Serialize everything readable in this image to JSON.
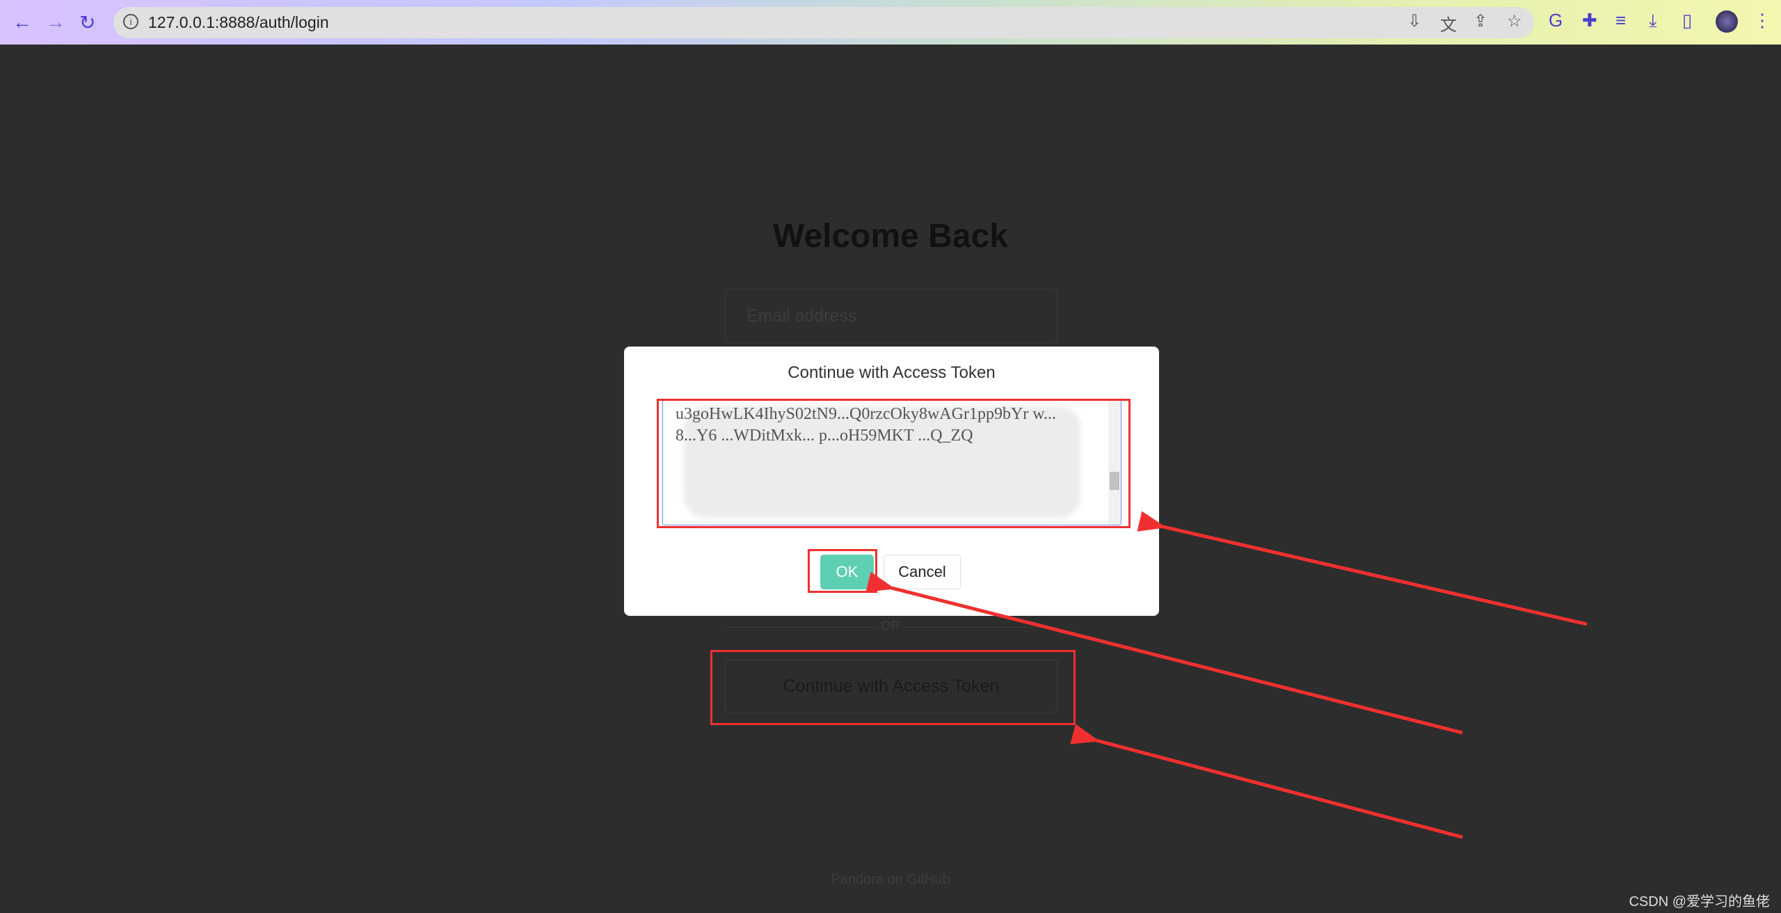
{
  "browser": {
    "url": "127.0.0.1:8888/auth/login"
  },
  "page": {
    "title": "Welcome Back",
    "email_placeholder": "Email address",
    "or_label": "OR",
    "continue_token_label": "Continue with Access Token",
    "footer_link": "Pandora on GitHub"
  },
  "dialog": {
    "title": "Continue with Access Token",
    "token_value": "u3goHwLK4IhyS02tN9...Q0rzcOky8wAGr1pp9bYr w... 8...Y6 ...WDitMxk... p...oH59MKT ...Q_ZQ",
    "ok_label": "OK",
    "cancel_label": "Cancel"
  },
  "watermark": "CSDN @爱学习的鱼佬",
  "colors": {
    "ok_button": "#5fcfb3",
    "annotation": "#f03030",
    "background": "#2d2d2d"
  }
}
